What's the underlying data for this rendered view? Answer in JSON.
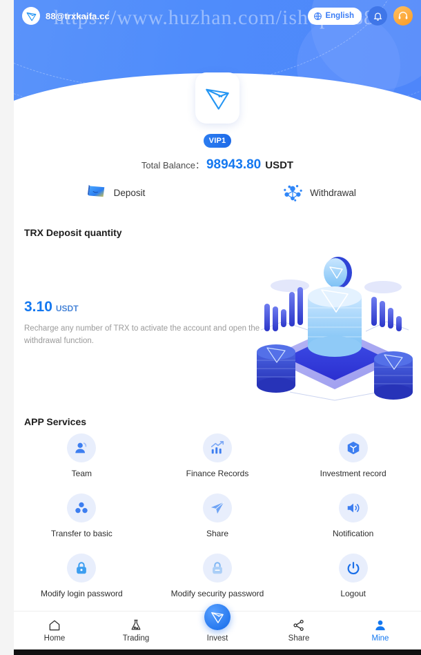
{
  "header": {
    "username": "88@trxkaifa.cc",
    "logo_icon": "tron-logo-icon",
    "language_label": "English",
    "language_icon": "globe-icon",
    "bell_icon": "bell-icon",
    "support_icon": "headset-icon",
    "watermark": "https://www.huzhan.com/ishop45889",
    "bg_color": "#5A93FA"
  },
  "profile": {
    "avatar_icon": "tron-logo-icon",
    "vip_badge": "VIP1",
    "balance_label": "Total Balance：",
    "balance_value": "98943.80",
    "balance_unit": "USDT",
    "balance_color": "#1478F0"
  },
  "actions": [
    {
      "label": "Deposit",
      "icon": "deposit-card-icon"
    },
    {
      "label": "Withdrawal",
      "icon": "withdrawal-network-icon"
    }
  ],
  "trx_section": {
    "title": "TRX Deposit quantity",
    "amount": "3.10",
    "unit": "USDT",
    "description": "Recharge any number of TRX to activate the account and open the withdrawal function.",
    "illustration": "crypto-isometric-illustration"
  },
  "services": {
    "title": "APP Services",
    "items": [
      {
        "label": "Team",
        "icon": "team-user-icon"
      },
      {
        "label": "Finance Records",
        "icon": "finance-chart-icon"
      },
      {
        "label": "Investment record",
        "icon": "cube-box-icon"
      },
      {
        "label": "Transfer to basic",
        "icon": "transfer-nodes-icon"
      },
      {
        "label": "Share",
        "icon": "share-send-icon"
      },
      {
        "label": "Notification",
        "icon": "speaker-icon"
      },
      {
        "label": "Modify login password",
        "icon": "lock-closed-icon"
      },
      {
        "label": "Modify security password",
        "icon": "lock-security-icon"
      },
      {
        "label": "Logout",
        "icon": "power-icon"
      }
    ]
  },
  "nav": {
    "items": [
      {
        "label": "Home",
        "icon": "home-icon",
        "active": false
      },
      {
        "label": "Trading",
        "icon": "trading-icon",
        "active": false
      },
      {
        "label": "Invest",
        "icon": "tron-logo-icon",
        "active": false,
        "center": true
      },
      {
        "label": "Share",
        "icon": "share-nodes-icon",
        "active": false
      },
      {
        "label": "Mine",
        "icon": "person-icon",
        "active": true
      }
    ],
    "active_color": "#1478F0"
  }
}
